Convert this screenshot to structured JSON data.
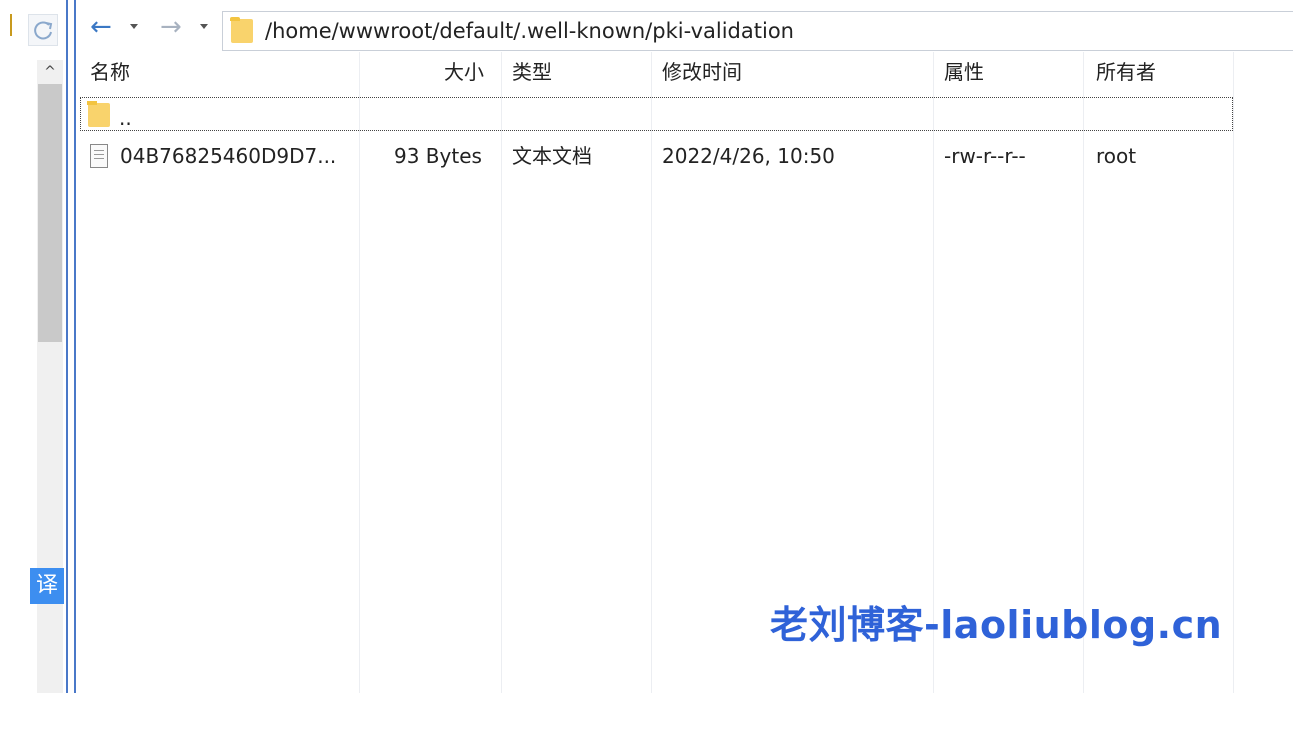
{
  "nav": {
    "back_glyph": "←",
    "forward_glyph": "→",
    "path": "/home/wwwroot/default/.well-known/pki-validation"
  },
  "columns": {
    "name": "名称",
    "size": "大小",
    "type": "类型",
    "modified": "修改时间",
    "attributes": "属性",
    "owner": "所有者"
  },
  "rows": [
    {
      "name": "..",
      "icon": "folder-icon"
    },
    {
      "name": "04B76825460D9D7...",
      "size": "93 Bytes",
      "type": "文本文档",
      "modified": "2022/4/26, 10:50",
      "attributes": "-rw-r--r--",
      "owner": "root",
      "icon": "file-icon"
    }
  ],
  "side": {
    "translate_label": "译",
    "scroll_up_glyph": "^"
  },
  "watermark": "老刘博客-laoliublog.cn",
  "colors": {
    "accent_line": "#4a78c8",
    "folder": "#f9d36c",
    "watermark": "#2f62d8",
    "translate_badge": "#3d8ef0"
  }
}
